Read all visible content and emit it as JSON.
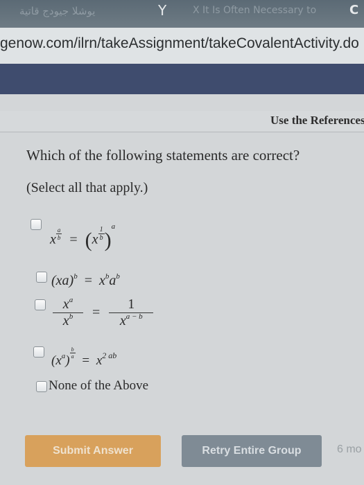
{
  "browser": {
    "tab_1_title": "يوشلا جيودج قاتية",
    "tab_2_icon": "Y",
    "tab_3_title": "X It Is Often Necessary to",
    "tab_4_icon": "C",
    "url": "genow.com/ilrn/takeAssignment/takeCovalentActivity.do"
  },
  "header": {
    "reference_link": "Use the References"
  },
  "question": {
    "text": "Which of the following statements are correct?",
    "instruction": "(Select all that apply.)",
    "options": [
      {
        "base": "x",
        "exp_num": "a",
        "exp_den": "b",
        "rhs_inner_num": "1",
        "rhs_inner_den": "b",
        "rhs_outer": "a"
      },
      {
        "lhs": "(xa)",
        "lhs_exp": "b",
        "rhs_a": "x",
        "rhs_a_exp": "b",
        "rhs_b": "a",
        "rhs_b_exp": "b"
      },
      {
        "num": "x",
        "num_exp": "a",
        "den": "x",
        "den_exp": "b",
        "rhs_num": "1",
        "rhs_den": "x",
        "rhs_den_exp": "a − b"
      },
      {
        "lhs": "(x",
        "lhs_inner_exp": "a",
        "lhs_close": ")",
        "lhs_outer_num": "b",
        "lhs_outer_den": "a",
        "rhs": "x",
        "rhs_exp": "2 ab"
      },
      {
        "label": "None of the Above"
      }
    ]
  },
  "footer": {
    "submit_label": "Submit Answer",
    "retry_label": "Retry Entire Group",
    "timer_text": "6 mo"
  }
}
